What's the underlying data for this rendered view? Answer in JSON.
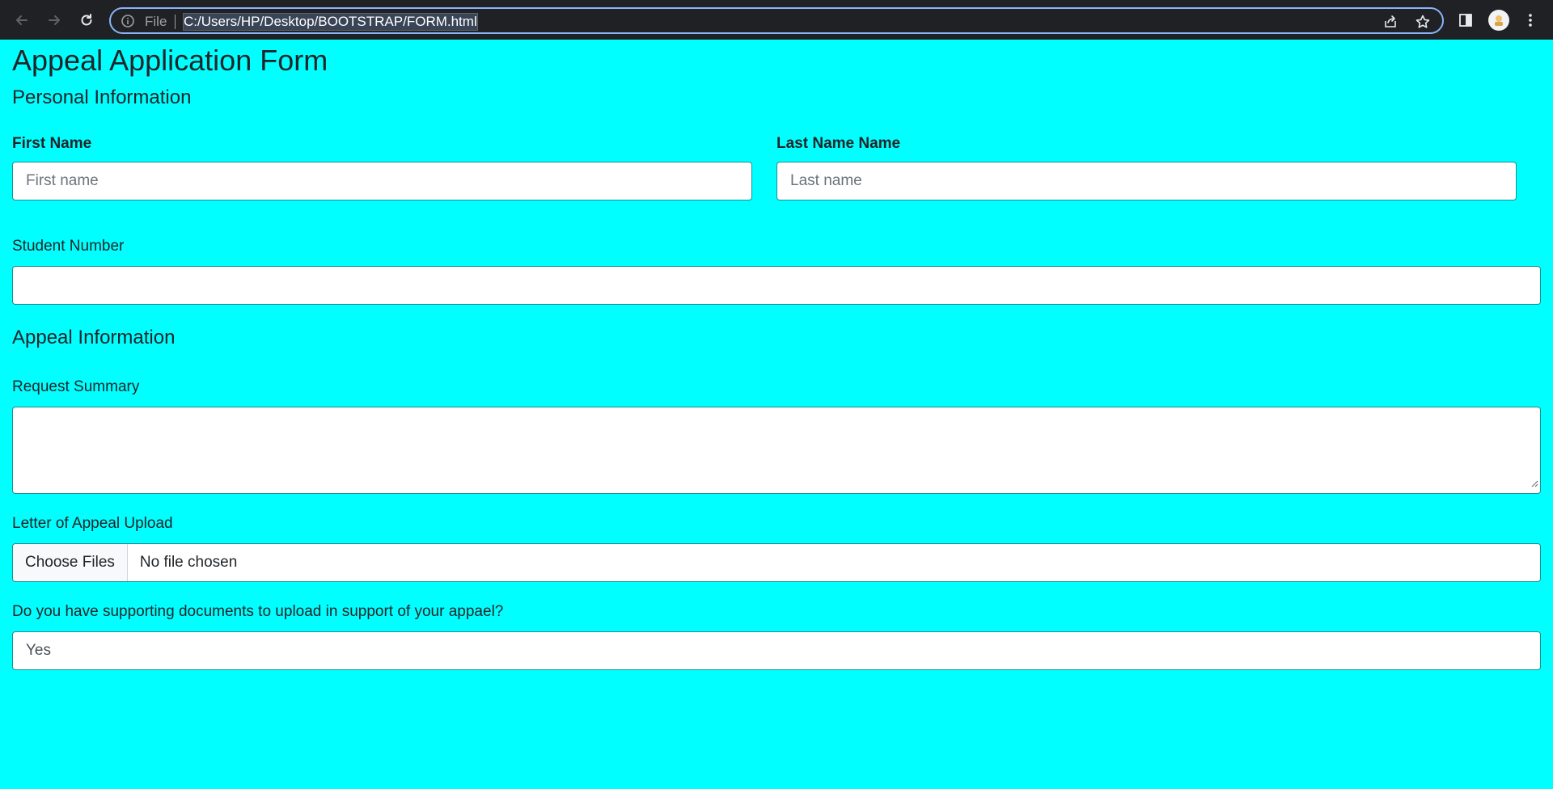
{
  "browser": {
    "scheme_label": "File",
    "url": "C:/Users/HP/Desktop/BOOTSTRAP/FORM.html"
  },
  "form": {
    "title": "Appeal Application Form",
    "personal_section": "Personal Information",
    "first_name_label": "First Name",
    "first_name_placeholder": "First name",
    "last_name_label": "Last Name Name",
    "last_name_placeholder": "Last name",
    "student_number_label": "Student Number",
    "student_number_value": "",
    "appeal_section": "Appeal Information",
    "request_summary_label": "Request Summary",
    "request_summary_value": "",
    "letter_upload_label": "Letter of Appeal Upload",
    "choose_files_label": "Choose Files",
    "file_status": "No file chosen",
    "supporting_docs_label": "Do you have supporting documents to upload in support of your appael?",
    "supporting_docs_selected": "Yes"
  },
  "colors": {
    "page_background": "#00ffff",
    "chrome_background": "#202124",
    "focus_ring": "#8ab4f8",
    "input_border": "#1a8f8f"
  },
  "icons": [
    "back-arrow-icon",
    "forward-arrow-icon",
    "reload-icon",
    "info-icon",
    "share-icon",
    "bookmark-star-icon",
    "side-panel-icon",
    "profile-avatar-icon",
    "menu-dots-icon"
  ]
}
